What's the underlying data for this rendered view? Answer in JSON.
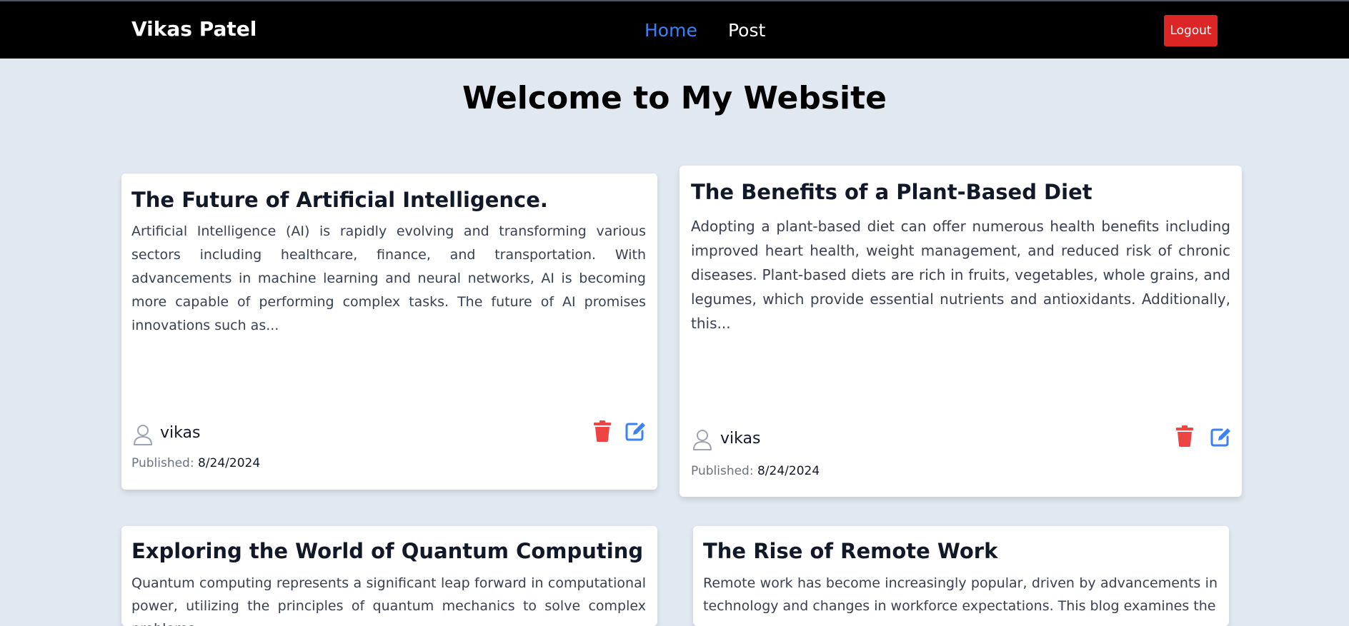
{
  "nav": {
    "brand": "Vikas Patel",
    "links": [
      {
        "label": "Home",
        "active": true
      },
      {
        "label": "Post",
        "active": false
      }
    ],
    "logout_label": "Logout"
  },
  "page": {
    "title": "Welcome to My Website"
  },
  "posts": [
    {
      "title": "The Future of Artificial Intelligence.",
      "excerpt": "Artificial Intelligence (AI) is rapidly evolving and transforming various sectors including healthcare, finance, and transportation. With advancements in machine learning and neural networks, AI is becoming more capable of performing complex tasks. The future of AI promises innovations such as...",
      "author": "vikas",
      "published_label": "Published:",
      "published_date": "8/24/2024"
    },
    {
      "title": "The Benefits of a Plant-Based Diet",
      "excerpt": "Adopting a plant-based diet can offer numerous health benefits including improved heart health, weight management, and reduced risk of chronic diseases. Plant-based diets are rich in fruits, vegetables, whole grains, and legumes, which provide essential nutrients and antioxidants. Additionally, this...",
      "author": "vikas",
      "published_label": "Published:",
      "published_date": "8/24/2024"
    },
    {
      "title": "Exploring the World of Quantum Computing",
      "excerpt": "Quantum computing represents a significant leap forward in computational power, utilizing the principles of quantum mechanics to solve complex problems"
    },
    {
      "title": "The Rise of Remote Work",
      "excerpt": "Remote work has become increasingly popular, driven by advancements in technology and changes in workforce expectations. This blog examines the"
    }
  ],
  "icons": {
    "author": "user-icon",
    "delete": "trash-icon",
    "edit": "edit-icon"
  },
  "colors": {
    "accent": "#3b82f6",
    "danger": "#ef4444",
    "logout": "#dc2626",
    "nav_bg": "#000000",
    "page_bg": "#e2e8f0"
  }
}
